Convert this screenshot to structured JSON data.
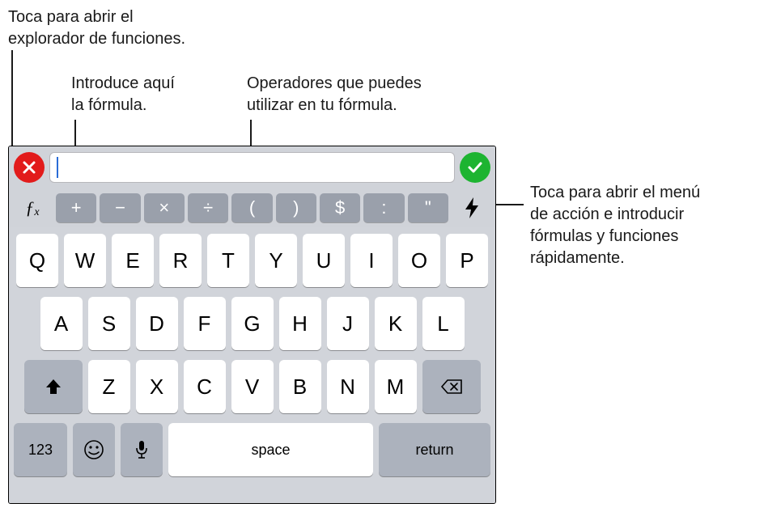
{
  "callouts": {
    "functions_browser": "Toca para abrir el\nexplorador de funciones.",
    "formula_input": "Introduce aquí\nla fórmula.",
    "operators": "Operadores que puedes\nutilizar en tu fórmula.",
    "action_menu": "Toca para abrir el menú\nde acción e introducir\nfórmulas y funciones\nrápidamente."
  },
  "formula_bar": {
    "fx_label": "ƒx",
    "input_value": "",
    "operators": [
      "+",
      "−",
      "×",
      "÷",
      "(",
      ")",
      "$",
      ":",
      "\""
    ]
  },
  "keyboard": {
    "row1": [
      "Q",
      "W",
      "E",
      "R",
      "T",
      "Y",
      "U",
      "I",
      "O",
      "P"
    ],
    "row2": [
      "A",
      "S",
      "D",
      "F",
      "G",
      "H",
      "J",
      "K",
      "L"
    ],
    "row3": [
      "Z",
      "X",
      "C",
      "V",
      "B",
      "N",
      "M"
    ],
    "bottom": {
      "numbers": "123",
      "space": "space",
      "return": "return"
    }
  }
}
